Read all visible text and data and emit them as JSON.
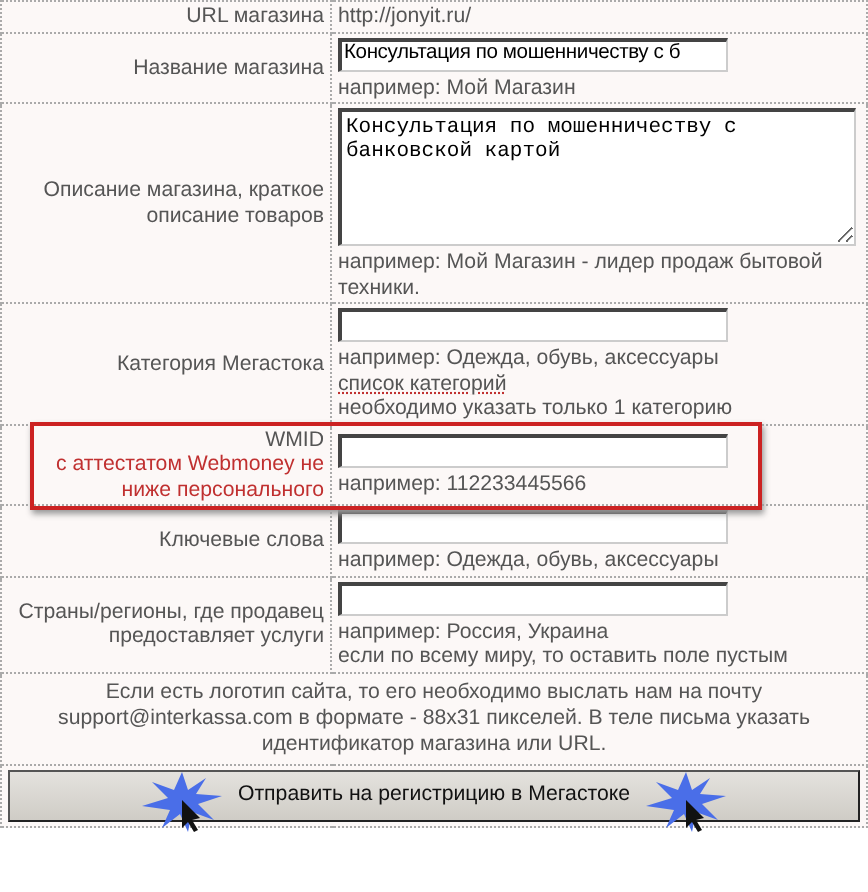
{
  "rows": [
    {
      "kind": "text",
      "label": "URL магазина",
      "value": "http://jonyit.ru/"
    },
    {
      "kind": "input",
      "label": "Название магазина",
      "value": "Консультация по мошенничеству с б",
      "hints": [
        "например: Мой Магазин"
      ]
    },
    {
      "kind": "textarea",
      "label": "Описание магазина, краткое описание товаров",
      "value": "Консультация по мошенничеству с банковской картой",
      "hints": [
        "например: Мой Магазин - лидер продаж бытовой техники."
      ]
    },
    {
      "kind": "input",
      "label": "Категория Мегастока",
      "value": "",
      "hints": [
        "например: Одежда, обувь, аксессуары"
      ],
      "link": "список категорий",
      "hints_after": [
        "необходимо указать только 1 категорию"
      ]
    },
    {
      "kind": "input",
      "label": "WMID",
      "sublabel": "с аттестатом Webmoney не ниже персонального",
      "highlighted": true,
      "value": "",
      "hints": [
        "например: 112233445566"
      ]
    },
    {
      "kind": "input",
      "label": "Ключевые слова",
      "value": "",
      "hints": [
        "например: Одежда, обувь, аксессуары"
      ]
    },
    {
      "kind": "input",
      "label": "Страны/регионы, где продавец предоставляет услуги",
      "value": "",
      "hints": [
        "например: Россия, Украина",
        "если по всему миру, то оставить поле пустым"
      ]
    }
  ],
  "note": "Если есть логотип сайта, то его необходимо выслать нам на почту support@interkassa.com в формате - 88x31 пикселей. В теле письма указать идентификатор магазина или URL.",
  "submit": "Отправить на регистрицию в Мегастоке"
}
